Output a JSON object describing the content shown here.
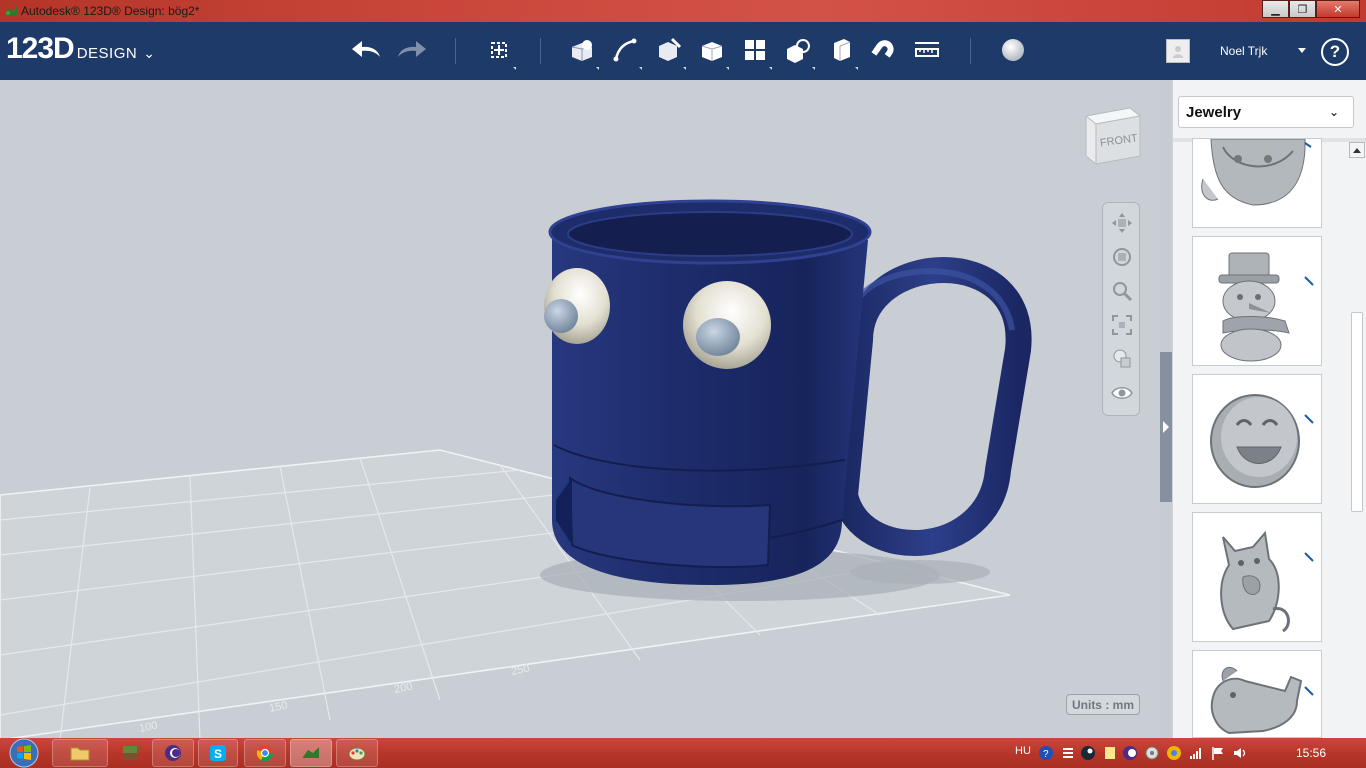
{
  "window": {
    "title": "Autodesk® 123D® Design: bög2*",
    "minimize_glyph": "▁",
    "maximize_glyph": "❐",
    "close_glyph": "✕"
  },
  "logo": {
    "big": "123D",
    "small": "DESIGN",
    "chevron": "⌄"
  },
  "toolbar": {
    "icons": [
      "undo-icon",
      "redo-icon",
      "transform-icon",
      "primitives-icon",
      "sketch-icon",
      "construct-icon",
      "modify-icon",
      "pattern-icon",
      "grouping-icon",
      "combine-icon",
      "measure-tool-icon",
      "snap-icon",
      "ruler-icon",
      "material-icon"
    ]
  },
  "user": {
    "name": "Noel Trjk",
    "help_glyph": "?"
  },
  "viewcube": {
    "face_label": "FRONT"
  },
  "units": {
    "label": "Units : mm"
  },
  "grid": {
    "tick_labels": [
      "100",
      "150",
      "200",
      "250"
    ]
  },
  "panel": {
    "category": "Jewelry",
    "dropdown_glyph": "⌄",
    "items": [
      "santa-charm",
      "snowman-charm",
      "smiley-charm",
      "cat-charm",
      "dog-charm"
    ]
  },
  "taskbar": {
    "apps": [
      "explorer",
      "minecraft",
      "eclipse",
      "skype",
      "chrome",
      "123d-design",
      "paint"
    ],
    "language": "HU",
    "time": "15:56"
  },
  "colors": {
    "titlebar": "#c4443a",
    "toolbar": "#1d3a68",
    "viewport": "#c8ced4",
    "mug": "#1f2e6e",
    "eye": "#e8e6dc",
    "pupil": "#8fa2b8"
  }
}
